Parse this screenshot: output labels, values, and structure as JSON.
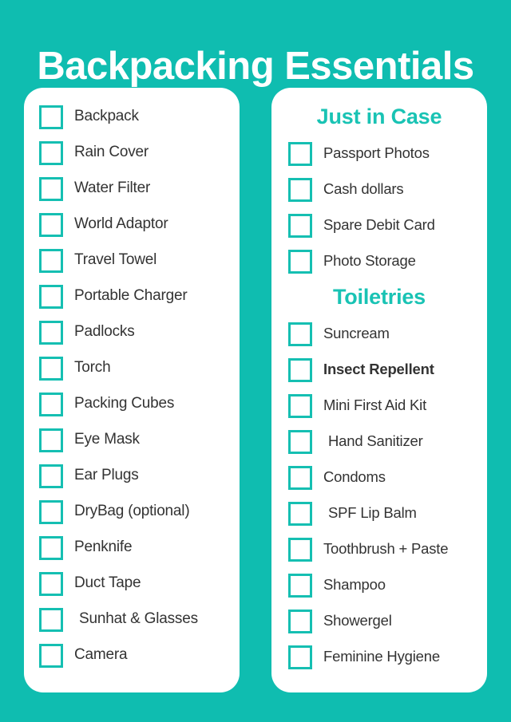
{
  "title": "Backpacking Essentials",
  "colors": {
    "background_teal": "#0FBDB0",
    "heading_teal": "#19C3B4",
    "checkbox_border": "#15BFB2",
    "card_background": "#FFFFFF",
    "item_text": "#333333",
    "title_text": "#FFFFFF"
  },
  "left_column": {
    "items": [
      {
        "label": "Backpack",
        "checked": false,
        "bold": false,
        "indent": false
      },
      {
        "label": "Rain Cover",
        "checked": false,
        "bold": false,
        "indent": false
      },
      {
        "label": "Water Filter",
        "checked": false,
        "bold": false,
        "indent": false
      },
      {
        "label": "World Adaptor",
        "checked": false,
        "bold": false,
        "indent": false
      },
      {
        "label": "Travel Towel",
        "checked": false,
        "bold": false,
        "indent": false
      },
      {
        "label": "Portable Charger",
        "checked": false,
        "bold": false,
        "indent": false
      },
      {
        "label": "Padlocks",
        "checked": false,
        "bold": false,
        "indent": false
      },
      {
        "label": "Torch",
        "checked": false,
        "bold": false,
        "indent": false
      },
      {
        "label": "Packing Cubes",
        "checked": false,
        "bold": false,
        "indent": false
      },
      {
        "label": "Eye Mask",
        "checked": false,
        "bold": false,
        "indent": false
      },
      {
        "label": "Ear Plugs",
        "checked": false,
        "bold": false,
        "indent": false
      },
      {
        "label": "DryBag (optional)",
        "checked": false,
        "bold": false,
        "indent": false
      },
      {
        "label": "Penknife",
        "checked": false,
        "bold": false,
        "indent": false
      },
      {
        "label": "Duct Tape",
        "checked": false,
        "bold": false,
        "indent": false
      },
      {
        "label": "Sunhat & Glasses",
        "checked": false,
        "bold": false,
        "indent": true
      },
      {
        "label": "Camera",
        "checked": false,
        "bold": false,
        "indent": false
      }
    ]
  },
  "right_column": {
    "sections": [
      {
        "heading": "Just in Case",
        "items": [
          {
            "label": "Passport Photos",
            "checked": false,
            "bold": false,
            "indent": false
          },
          {
            "label": "Cash dollars",
            "checked": false,
            "bold": false,
            "indent": false
          },
          {
            "label": "Spare Debit Card",
            "checked": false,
            "bold": false,
            "indent": false
          },
          {
            "label": "Photo Storage",
            "checked": false,
            "bold": false,
            "indent": false
          }
        ]
      },
      {
        "heading": "Toiletries",
        "items": [
          {
            "label": "Suncream",
            "checked": false,
            "bold": false,
            "indent": false
          },
          {
            "label": "Insect Repellent",
            "checked": false,
            "bold": true,
            "indent": false
          },
          {
            "label": "Mini First Aid Kit",
            "checked": false,
            "bold": false,
            "indent": false
          },
          {
            "label": "Hand Sanitizer",
            "checked": false,
            "bold": false,
            "indent": true
          },
          {
            "label": "Condoms",
            "checked": false,
            "bold": false,
            "indent": false
          },
          {
            "label": "SPF Lip Balm",
            "checked": false,
            "bold": false,
            "indent": true
          },
          {
            "label": "Toothbrush + Paste",
            "checked": false,
            "bold": false,
            "indent": false
          },
          {
            "label": "Shampoo",
            "checked": false,
            "bold": false,
            "indent": false
          },
          {
            "label": "Showergel",
            "checked": false,
            "bold": false,
            "indent": false
          },
          {
            "label": "Feminine Hygiene",
            "checked": false,
            "bold": false,
            "indent": false
          }
        ]
      }
    ]
  }
}
